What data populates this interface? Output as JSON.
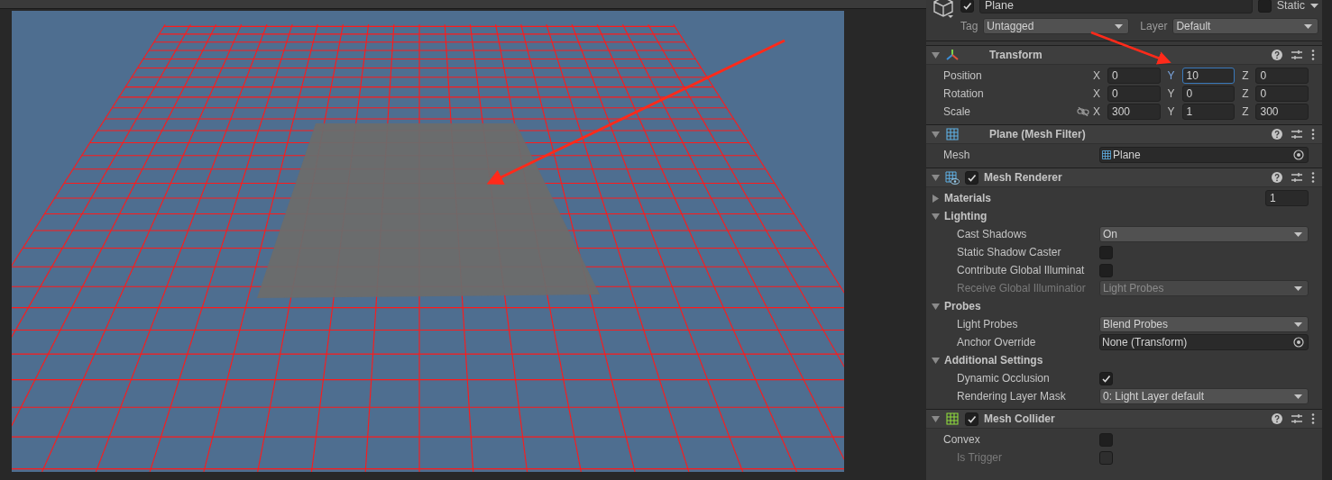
{
  "inspector": {
    "object": {
      "active": true,
      "name": "Plane",
      "static": false,
      "static_label": "Static",
      "tag_label": "Tag",
      "tag": "Untagged",
      "layer_label": "Layer",
      "layer": "Default"
    },
    "components": [
      {
        "kind": "transform",
        "title": "Transform",
        "rows": [
          {
            "kind": "vector3",
            "label": "Position",
            "fields": [
              {
                "axis": "X",
                "value": "0",
                "focused": false
              },
              {
                "axis": "Y",
                "value": "10",
                "focused": true
              },
              {
                "axis": "Z",
                "value": "0",
                "focused": false
              }
            ]
          },
          {
            "kind": "vector3",
            "label": "Rotation",
            "fields": [
              {
                "axis": "X",
                "value": "0",
                "focused": false
              },
              {
                "axis": "Y",
                "value": "0",
                "focused": false
              },
              {
                "axis": "Z",
                "value": "0",
                "focused": false
              }
            ]
          },
          {
            "kind": "vector3",
            "label": "Scale",
            "constrained": false,
            "fields": [
              {
                "axis": "X",
                "value": "300",
                "focused": false
              },
              {
                "axis": "Y",
                "value": "1",
                "focused": false
              },
              {
                "axis": "Z",
                "value": "300",
                "focused": false
              }
            ]
          }
        ]
      },
      {
        "kind": "mesh_filter",
        "title": "Plane (Mesh Filter)",
        "rows": [
          {
            "kind": "object",
            "label": "Mesh",
            "value": "Plane",
            "asset": true,
            "disabled": false
          }
        ]
      },
      {
        "kind": "mesh_renderer",
        "title": "Mesh Renderer",
        "enabled": true,
        "rows": [
          {
            "kind": "foldout",
            "label": "Materials",
            "expanded": false,
            "value": "1"
          },
          {
            "kind": "foldout",
            "label": "Lighting",
            "expanded": true,
            "children": [
              {
                "kind": "dropdown",
                "label": "Cast Shadows",
                "value": "On",
                "disabled": false
              },
              {
                "kind": "toggle",
                "label": "Static Shadow Caster",
                "checked": false,
                "disabled": false
              },
              {
                "kind": "toggle",
                "label": "Contribute Global Illuminat",
                "checked": false,
                "disabled": false
              },
              {
                "kind": "dropdown",
                "label": "Receive Global Illuminatior",
                "value": "Light Probes",
                "disabled": true
              }
            ]
          },
          {
            "kind": "foldout",
            "label": "Probes",
            "expanded": true,
            "children": [
              {
                "kind": "dropdown",
                "label": "Light Probes",
                "value": "Blend Probes",
                "disabled": false
              },
              {
                "kind": "object",
                "label": "Anchor Override",
                "value": "None (Transform)",
                "asset": false,
                "disabled": false
              }
            ]
          },
          {
            "kind": "foldout",
            "label": "Additional Settings",
            "expanded": true,
            "children": [
              {
                "kind": "toggle",
                "label": "Dynamic Occlusion",
                "checked": true,
                "disabled": false
              },
              {
                "kind": "dropdown",
                "label": "Rendering Layer Mask",
                "value": "0: Light Layer default",
                "disabled": false
              }
            ]
          }
        ]
      },
      {
        "kind": "mesh_collider",
        "title": "Mesh Collider",
        "enabled": true,
        "rows": [
          {
            "kind": "toggle",
            "label": "Convex",
            "checked": false,
            "disabled": false,
            "children": [
              {
                "kind": "toggle",
                "label": "Is Trigger",
                "checked": false,
                "disabled": true
              }
            ]
          }
        ]
      }
    ]
  }
}
